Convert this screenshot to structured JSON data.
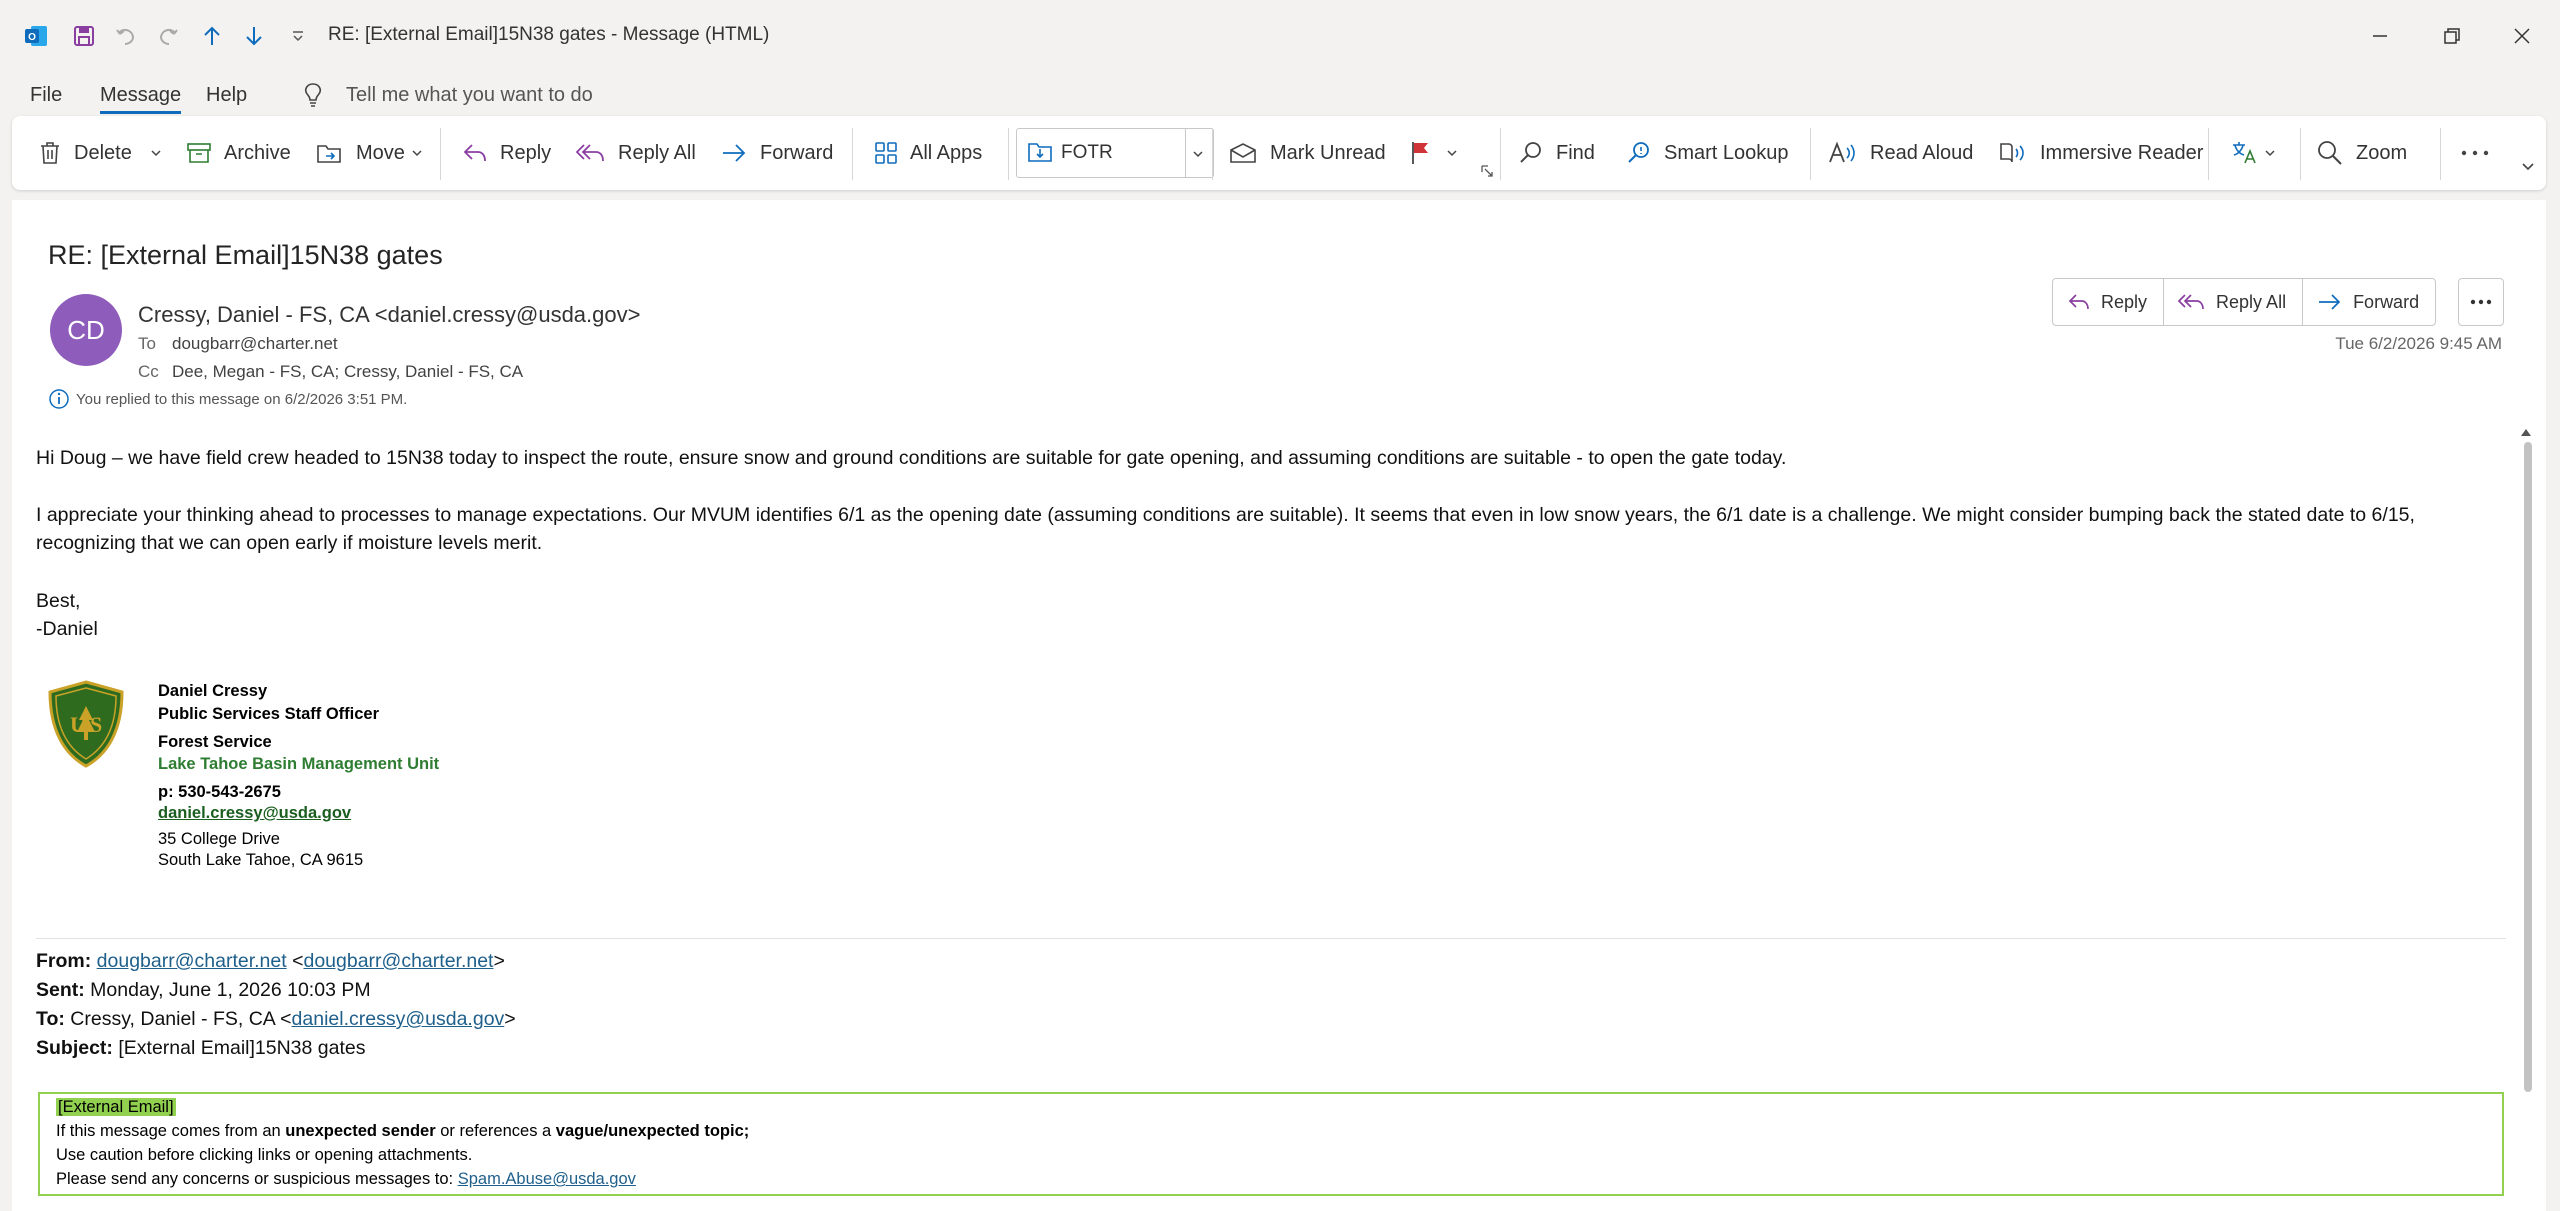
{
  "window": {
    "title": "RE: [External Email]15N38 gates  -  Message (HTML)"
  },
  "menu": {
    "file": "File",
    "message": "Message",
    "help": "Help",
    "tell_me": "Tell me what you want to do"
  },
  "ribbon": {
    "delete": "Delete",
    "archive": "Archive",
    "move": "Move",
    "reply": "Reply",
    "reply_all": "Reply All",
    "forward": "Forward",
    "all_apps": "All Apps",
    "quick_step": "FOTR",
    "mark_unread": "Mark Unread",
    "find": "Find",
    "smart_lookup": "Smart Lookup",
    "read_aloud": "Read Aloud",
    "immersive_reader": "Immersive Reader",
    "zoom": "Zoom"
  },
  "message": {
    "subject": "RE: [External Email]15N38 gates",
    "avatar_initials": "CD",
    "sender": "Cressy, Daniel - FS, CA <daniel.cressy@usda.gov>",
    "to_label": "To",
    "to": "dougbarr@charter.net",
    "cc_label": "Cc",
    "cc": "Dee, Megan - FS, CA; Cressy, Daniel - FS, CA",
    "replied_note": "You replied to this message on 6/2/2026 3:51 PM.",
    "date": "Tue 6/2/2026 9:45 AM",
    "actions": {
      "reply": "Reply",
      "reply_all": "Reply All",
      "forward": "Forward"
    },
    "body": {
      "p1": "Hi Doug – we have field crew headed to 15N38 today to inspect the route, ensure snow and ground conditions are suitable for gate opening, and assuming conditions are suitable - to open the gate today.",
      "p2": "I appreciate your thinking ahead to processes to manage expectations.   Our MVUM identifies 6/1 as the opening date (assuming conditions are suitable).   It seems that even in low snow years, the 6/1 date is a challenge.  We might consider bumping back the stated date to 6/15, recognizing that we can open early if moisture levels merit.",
      "closing": "Best,",
      "name_line": "-Daniel"
    },
    "signature": {
      "logo_text": "FOREST SERVICE · US · DEPARTMENT OF AGRICULTURE",
      "name": "Daniel Cressy",
      "title": "Public Services Staff Officer",
      "org": "Forest Service",
      "unit": "Lake Tahoe Basin Management Unit",
      "phone": "p: 530-543-2675",
      "email": "daniel.cressy@usda.gov",
      "address1": "35 College Drive",
      "address2": "South Lake Tahoe, CA 9615"
    },
    "forwarded": {
      "from_label": "From:",
      "from_email": "dougbarr@charter.net",
      "from_email2": "dougbarr@charter.net",
      "sent_label": "Sent:",
      "sent": "Monday, June 1, 2026 10:03 PM",
      "to_label": "To:",
      "to_name": "Cressy, Daniel - FS, CA <",
      "to_email": "daniel.cressy@usda.gov",
      "subject_label": "Subject:",
      "subject": "[External Email]15N38 gates"
    },
    "external_banner": {
      "tag": "[External Email]",
      "l2_a": "If this message comes from an ",
      "l2_b": "unexpected sender",
      "l2_c": " or references a ",
      "l2_d": "vague/unexpected topic;",
      "l3": "Use caution before clicking links or opening attachments.",
      "l4_a": "Please send any concerns or suspicious messages to: ",
      "l4_link": "Spam.Abuse@usda.gov"
    }
  },
  "colors": {
    "avatar": "#8e5cbb",
    "accent": "#0f6cbd",
    "reply_purple": "#8a3ea0",
    "external_green": "#92d050"
  }
}
